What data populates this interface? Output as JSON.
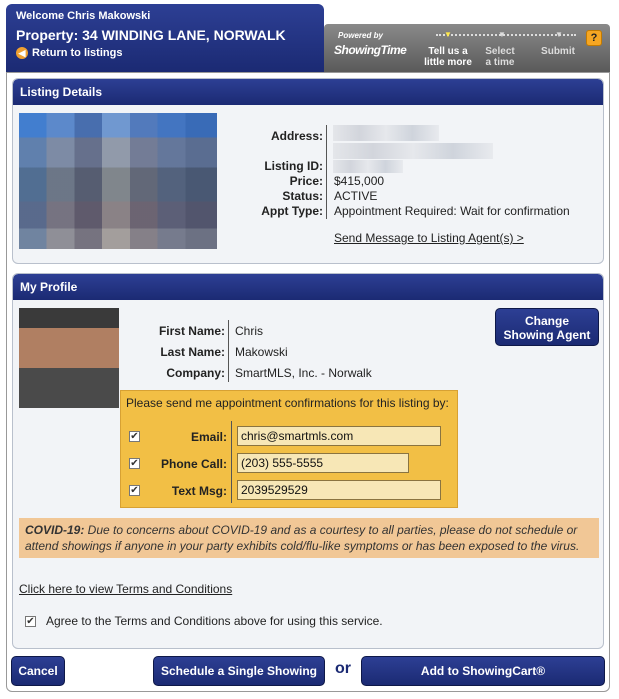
{
  "header": {
    "welcome": "Welcome Chris Makowski",
    "property": "Property: 34 WINDING LANE, NORWALK",
    "back_label": "Return to listings"
  },
  "showingtime": {
    "powered_by": "Powered by",
    "logo_text": "ShowingTime",
    "steps": [
      {
        "label_line1": "Tell us a",
        "label_line2": "little more",
        "active": true
      },
      {
        "label_line1": "Select",
        "label_line2": "a time",
        "active": false
      },
      {
        "label_line1": "Submit",
        "label_line2": "",
        "active": false
      }
    ],
    "help_label": "?"
  },
  "listing": {
    "title": "Listing Details",
    "address_label": "Address:",
    "listing_id_label": "Listing ID:",
    "price_label": "Price:",
    "price": "$415,000",
    "status_label": "Status:",
    "status": "ACTIVE",
    "appt_type_label": "Appt Type:",
    "appt_type": "Appointment Required: Wait for confirmation",
    "message_link": "Send Message to Listing Agent(s) >"
  },
  "profile": {
    "title": "My Profile",
    "first_name_label": "First Name:",
    "first_name": "Chris",
    "last_name_label": "Last Name:",
    "last_name": "Makowski",
    "company_label": "Company:",
    "company": "SmartMLS, Inc. - Norwalk",
    "change_agent_line1": "Change",
    "change_agent_line2": "Showing Agent",
    "confirm_prompt": "Please send me appointment confirmations for this listing by:",
    "email_label": "Email:",
    "email": "chris@smartmls.com",
    "phone_label": "Phone Call:",
    "phone": "(203) 555-5555",
    "text_label": "Text Msg:",
    "text": "2039529529",
    "covid_label": "COVID-19:",
    "covid_text": " Due to concerns about COVID-19 and as a courtesy to all parties, please do not schedule or attend showings if anyone in your party exhibits cold/flu-like symptoms or has been exposed to the virus.",
    "terms_link": "Click here to view Terms and Conditions",
    "agree_label": "Agree to the Terms and Conditions above for using this service.",
    "check_mark": "✔"
  },
  "footer": {
    "cancel_label": "Cancel",
    "schedule_label": "Schedule a Single Showing",
    "or_label": "or",
    "cart_label": "Add to ShowingCart®"
  },
  "colors": {
    "navy": "#1b2a73",
    "confirm_bg": "#f2bf45",
    "covid_bg": "#f1c796",
    "help_orange": "#f5a623"
  }
}
